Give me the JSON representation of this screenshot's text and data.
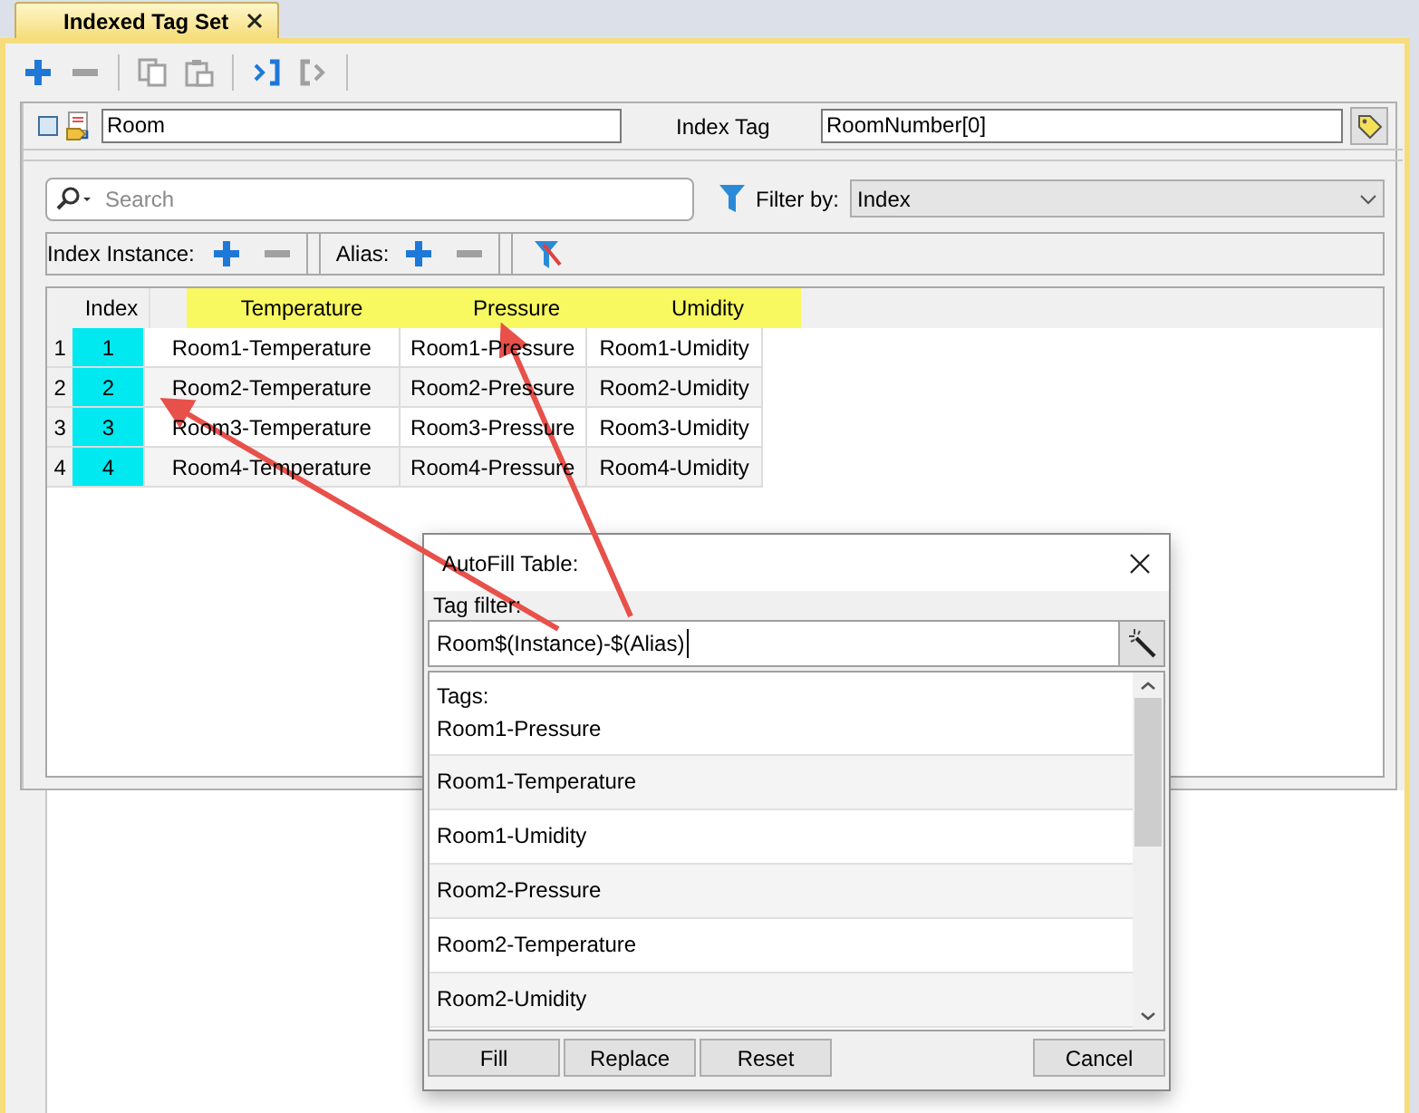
{
  "tab": {
    "title": "Indexed Tag Set"
  },
  "toolbar": [
    {
      "kind": "add",
      "disabled": false
    },
    {
      "kind": "remove",
      "disabled": true
    },
    {
      "kind": "copy",
      "disabled": true
    },
    {
      "kind": "paste",
      "disabled": true
    },
    {
      "kind": "import",
      "disabled": false
    },
    {
      "kind": "export",
      "disabled": true
    }
  ],
  "name_field": {
    "value": "Room"
  },
  "index_tag": {
    "label": "Index Tag",
    "value": "RoomNumber[0]"
  },
  "search": {
    "placeholder": "Search"
  },
  "filter": {
    "label": "Filter by:",
    "value": "Index"
  },
  "index_instance": {
    "label": "Index Instance:"
  },
  "alias": {
    "label": "Alias:"
  },
  "table": {
    "columns": [
      {
        "label": "Index",
        "highlighted": false
      },
      {
        "label": "Temperature",
        "highlighted": true
      },
      {
        "label": "Pressure",
        "highlighted": true
      },
      {
        "label": "Umidity",
        "highlighted": true
      }
    ],
    "rows": [
      {
        "number": "1",
        "cells": [
          "1",
          "Room1-Temperature",
          "Room1-Pressure",
          "Room1-Umidity"
        ]
      },
      {
        "number": "2",
        "cells": [
          "2",
          "Room2-Temperature",
          "Room2-Pressure",
          "Room2-Umidity"
        ]
      },
      {
        "number": "3",
        "cells": [
          "3",
          "Room3-Temperature",
          "Room3-Pressure",
          "Room3-Umidity"
        ]
      },
      {
        "number": "4",
        "cells": [
          "4",
          "Room4-Temperature",
          "Room4-Pressure",
          "Room4-Umidity"
        ]
      }
    ]
  },
  "dialog": {
    "title": "AutoFill Table:",
    "filter_label": "Tag filter:",
    "filter_value": "Room$(Instance)-$(Alias)",
    "tags_label": "Tags:",
    "tags": [
      "Room1-Pressure",
      "Room1-Temperature",
      "Room1-Umidity",
      "Room2-Pressure",
      "Room2-Temperature",
      "Room2-Umidity"
    ],
    "buttons": [
      "Fill",
      "Replace",
      "Reset"
    ],
    "cancel": "Cancel"
  }
}
